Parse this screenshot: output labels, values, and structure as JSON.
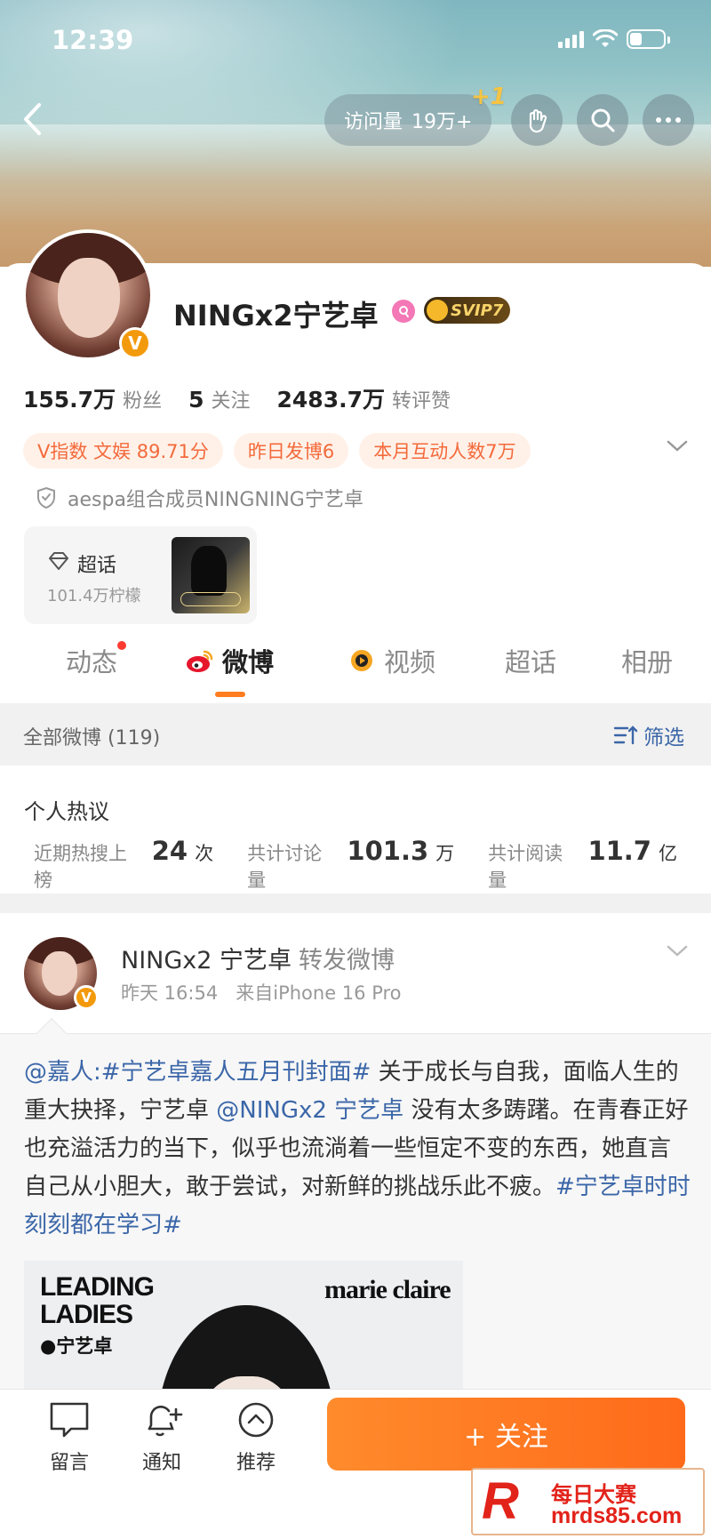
{
  "status_bar": {
    "time": "12:39"
  },
  "header": {
    "visit_label": "访问量",
    "visit_count": "19万+",
    "visit_delta": "+1"
  },
  "profile": {
    "name": "NINGx2宁艺卓",
    "v_badge": "V",
    "svip": "SVIP7",
    "stats": [
      {
        "num": "155.7万",
        "label": "粉丝"
      },
      {
        "num": "5",
        "label": "关注"
      },
      {
        "num": "2483.7万",
        "label": "转评赞"
      }
    ],
    "tags": [
      "V指数 文娱 89.71分",
      "昨日发博6",
      "本月互动人数7万"
    ],
    "verification": "aespa组合成员NINGNING宁艺卓",
    "super_topic": {
      "title": "超话",
      "subtitle": "101.4万柠檬"
    }
  },
  "tabs": [
    {
      "label": "动态",
      "active": false
    },
    {
      "label": "微博",
      "active": true
    },
    {
      "label": "视频",
      "active": false
    },
    {
      "label": "超话",
      "active": false
    },
    {
      "label": "相册",
      "active": false
    }
  ],
  "filter_bar": {
    "all_label": "全部微博 (119)",
    "filter_label": "筛选"
  },
  "hot": {
    "title": "个人热议",
    "items": [
      {
        "label": "近期热搜上榜",
        "value": "24",
        "unit": "次"
      },
      {
        "label": "共计讨论量",
        "value": "101.3",
        "unit": "万"
      },
      {
        "label": "共计阅读量",
        "value": "11.7",
        "unit": "亿"
      }
    ]
  },
  "post": {
    "author": "NINGx2 宁艺卓",
    "action": "转发微博",
    "time": "昨天 16:54",
    "source": "来自iPhone 16 Pro",
    "quote": {
      "mention": "@嘉人",
      "colon": ":",
      "topic1": "#宁艺卓嘉人五月刊封面#",
      "text1": " 关于成长与自我，面临人生的重大抉择，宁艺卓 ",
      "mention2": "@NINGx2 宁艺卓",
      "text2": " 没有太多踌躇。在青春正好也充溢活力的当下，似乎也流淌着一些恒定不变的东西，她直言自己从小胆大，敢于尝试，对新鲜的挑战乐此不疲。",
      "topic2": "#宁艺卓时时刻刻都在学习#"
    },
    "cover": {
      "leading": "LEADING",
      "ladies": "LADIES",
      "person": "●宁艺卓",
      "magazine": "marie claire"
    }
  },
  "bottom_bar": {
    "comment": "留言",
    "notify": "通知",
    "recommend": "推荐",
    "follow": "+ 关注"
  },
  "watermark": {
    "line1": "每日大赛",
    "line2": "mrds85.com",
    "mark": "R"
  },
  "colors": {
    "accent": "#ff7c1f",
    "link": "#3b66a8",
    "tag_bg": "#fff1e8",
    "tag_text": "#f36a3b"
  }
}
